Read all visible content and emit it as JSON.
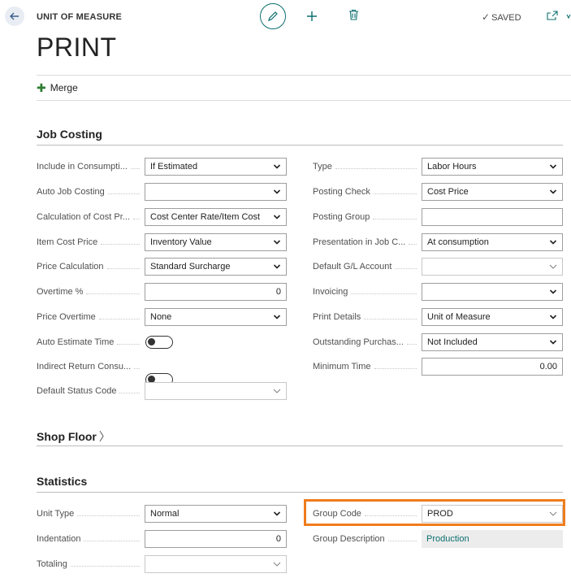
{
  "header": {
    "entity_type": "UNIT OF MEASURE",
    "title": "PRINT",
    "saved_label": "SAVED"
  },
  "actions": {
    "merge_label": "Merge"
  },
  "sections": {
    "job_costing": "Job Costing",
    "shop_floor": "Shop Floor",
    "statistics": "Statistics"
  },
  "job_costing": {
    "left": [
      {
        "label": "Include in Consumpti...",
        "value": "If Estimated"
      },
      {
        "label": "Auto Job Costing",
        "value": ""
      },
      {
        "label": "Calculation of Cost Pr...",
        "value": "Cost Center Rate/Item Cost"
      },
      {
        "label": "Item Cost Price",
        "value": "Inventory Value"
      },
      {
        "label": "Price Calculation",
        "value": "Standard Surcharge"
      },
      {
        "label": "Overtime %",
        "value": "0"
      },
      {
        "label": "Price Overtime",
        "value": "None"
      },
      {
        "label": "Auto Estimate Time",
        "value": ""
      },
      {
        "label": "Indirect Return Consu...",
        "value": ""
      },
      {
        "label": "Default Status Code",
        "value": ""
      }
    ],
    "right": [
      {
        "label": "Type",
        "value": "Labor Hours"
      },
      {
        "label": "Posting Check",
        "value": "Cost Price"
      },
      {
        "label": "Posting Group",
        "value": ""
      },
      {
        "label": "Presentation in Job C...",
        "value": "At consumption"
      },
      {
        "label": "Default G/L Account",
        "value": ""
      },
      {
        "label": "Invoicing",
        "value": ""
      },
      {
        "label": "Print Details",
        "value": "Unit of Measure"
      },
      {
        "label": "Outstanding Purchas...",
        "value": "Not Included"
      },
      {
        "label": "Minimum Time",
        "value": "0.00"
      }
    ]
  },
  "statistics": {
    "left": [
      {
        "label": "Unit Type",
        "value": "Normal"
      },
      {
        "label": "Indentation",
        "value": "0"
      },
      {
        "label": "Totaling",
        "value": ""
      }
    ],
    "right": [
      {
        "label": "Group Code",
        "value": "PROD"
      },
      {
        "label": "Group Description",
        "value": "Production"
      }
    ]
  },
  "icons": {
    "back": "arrow-left-icon",
    "edit": "pencil-icon",
    "new": "plus-icon",
    "delete": "trash-icon",
    "popout": "popout-icon",
    "collapse": "collapse-icon"
  },
  "colors": {
    "accent": "#0b6e6e",
    "highlight": "#f07c1c",
    "merge_plus": "#2e7d32"
  }
}
